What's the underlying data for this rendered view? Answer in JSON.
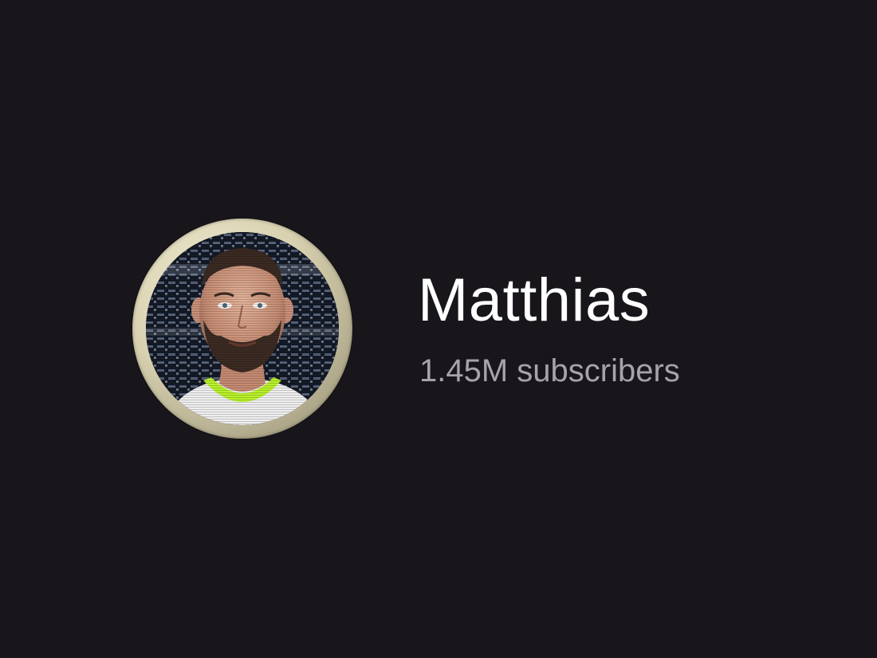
{
  "channel": {
    "name": "Matthias",
    "subscribers": "1.45M subscribers",
    "avatar_description": "avatar"
  },
  "colors": {
    "background": "#18161b",
    "name_text": "#ffffff",
    "subscriber_text": "#a6a4aa",
    "avatar_ring": "#d8d1b0",
    "collar_accent": "#b8f02a"
  }
}
